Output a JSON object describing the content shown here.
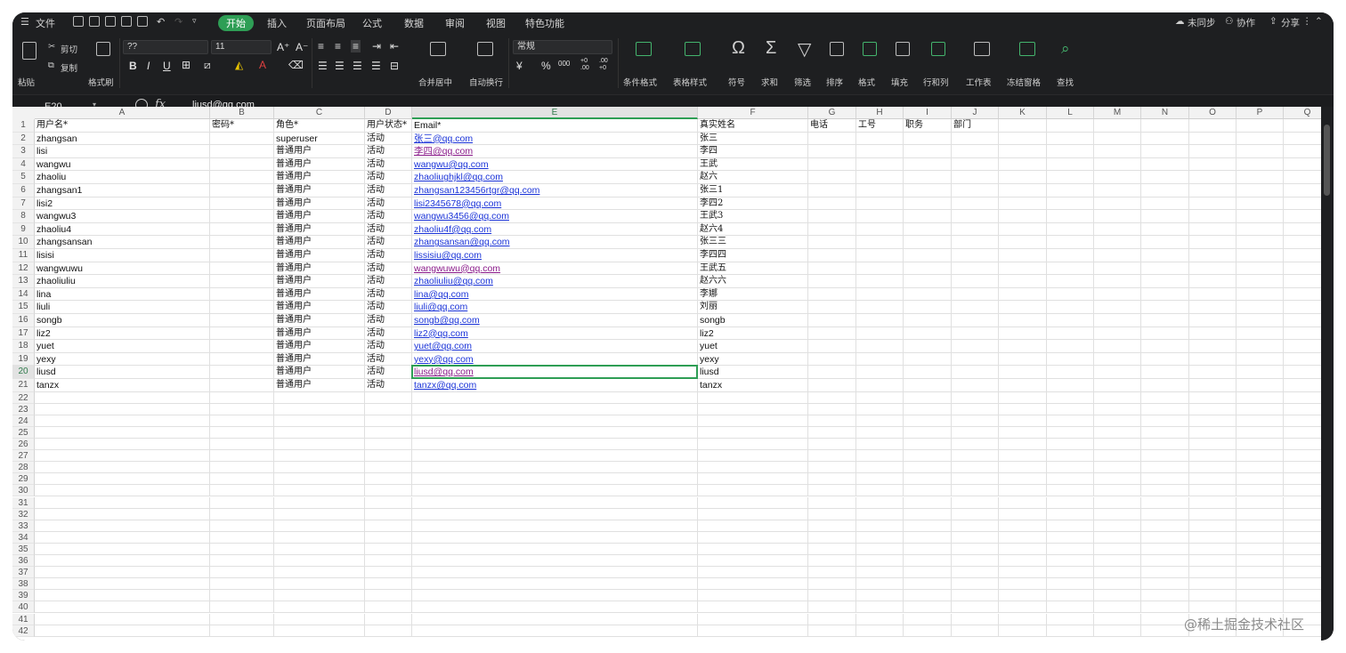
{
  "menubar": {
    "file": "文件",
    "tabs": [
      "开始",
      "插入",
      "页面布局",
      "公式",
      "数据",
      "审阅",
      "视图",
      "特色功能"
    ],
    "sync": "未同步",
    "collab": "协作",
    "share": "分享"
  },
  "ribbon": {
    "paste": "粘贴",
    "cut": "剪切",
    "copy": "复制",
    "format_painter": "格式刷",
    "font_name": "??",
    "font_size": "11",
    "merge_center": "合并居中",
    "wrap": "自动换行",
    "number_format": "常规",
    "cond_format": "条件格式",
    "table_style": "表格样式",
    "symbol": "符号",
    "sum": "求和",
    "filter": "筛选",
    "sort": "排序",
    "format": "格式",
    "fill": "填充",
    "row_col": "行和列",
    "worksheet": "工作表",
    "freeze": "冻结窗格",
    "find": "查找",
    "currency": "¥",
    "percent": "%",
    "thousands": "000",
    "dec_inc": "+0 .00",
    "dec_dec": ".00 +0"
  },
  "formula_bar": {
    "cell_ref": "E20",
    "fx": "fx",
    "value": "liusd@qq.com"
  },
  "columns": [
    "A",
    "B",
    "C",
    "D",
    "E",
    "F",
    "G",
    "H",
    "I",
    "J",
    "K",
    "L",
    "M",
    "N",
    "O",
    "P",
    "Q"
  ],
  "selected_column": "E",
  "selected_row": 20,
  "header_row": [
    "用户名*",
    "密码*",
    "角色*",
    "用户状态*",
    "Email*",
    "真实姓名",
    "电话",
    "工号",
    "职务",
    "部门"
  ],
  "rows": [
    {
      "n": "2",
      "a": "zhangsan",
      "c": "superuser",
      "d": "活动",
      "e": "张三@qq.com",
      "f": "张三",
      "visited": false
    },
    {
      "n": "3",
      "a": "lisi",
      "c": "普通用户",
      "d": "活动",
      "e": "李四@qq.com",
      "f": "李四",
      "visited": true
    },
    {
      "n": "4",
      "a": "wangwu",
      "c": "普通用户",
      "d": "活动",
      "e": "wangwu@qq.com",
      "f": "王武",
      "visited": false
    },
    {
      "n": "5",
      "a": "zhaoliu",
      "c": "普通用户",
      "d": "活动",
      "e": "zhaoliughjkl@qq.com",
      "f": "赵六",
      "visited": false
    },
    {
      "n": "6",
      "a": "zhangsan1",
      "c": "普通用户",
      "d": "活动",
      "e": "zhangsan123456rtgr@qq.com",
      "f": "张三1",
      "visited": false
    },
    {
      "n": "7",
      "a": "lisi2",
      "c": "普通用户",
      "d": "活动",
      "e": "lisi2345678@qq.com",
      "f": "李四2",
      "visited": false
    },
    {
      "n": "8",
      "a": "wangwu3",
      "c": "普通用户",
      "d": "活动",
      "e": "wangwu3456@qq.com",
      "f": "王武3",
      "visited": false
    },
    {
      "n": "9",
      "a": "zhaoliu4",
      "c": "普通用户",
      "d": "活动",
      "e": "zhaoliu4f@qq.com",
      "f": "赵六4",
      "visited": false
    },
    {
      "n": "10",
      "a": "zhangsansan",
      "c": "普通用户",
      "d": "活动",
      "e": "zhangsansan@qq.com",
      "f": "张三三",
      "visited": false
    },
    {
      "n": "11",
      "a": "lisisi",
      "c": "普通用户",
      "d": "活动",
      "e": "lissisiu@qq.com",
      "f": "李四四",
      "visited": false
    },
    {
      "n": "12",
      "a": "wangwuwu",
      "c": "普通用户",
      "d": "活动",
      "e": "wangwuwu@qq.com",
      "f": "王武五",
      "visited": true
    },
    {
      "n": "13",
      "a": "zhaoliuliu",
      "c": "普通用户",
      "d": "活动",
      "e": "zhaoliuliu@qq.com",
      "f": "赵六六",
      "visited": false
    },
    {
      "n": "14",
      "a": "lina",
      "c": "普通用户",
      "d": "活动",
      "e": "lina@qq.com",
      "f": "李娜",
      "visited": false
    },
    {
      "n": "15",
      "a": "liuli",
      "c": "普通用户",
      "d": "活动",
      "e": "liuli@qq.com",
      "f": "刘丽",
      "visited": false
    },
    {
      "n": "16",
      "a": "songb",
      "c": "普通用户",
      "d": "活动",
      "e": "songb@qq.com",
      "f": "songb",
      "visited": false
    },
    {
      "n": "17",
      "a": "liz2",
      "c": "普通用户",
      "d": "活动",
      "e": "liz2@qq.com",
      "f": "liz2",
      "visited": false
    },
    {
      "n": "18",
      "a": "yuet",
      "c": "普通用户",
      "d": "活动",
      "e": "yuet@qq.com",
      "f": "yuet",
      "visited": false
    },
    {
      "n": "19",
      "a": "yexy",
      "c": "普通用户",
      "d": "活动",
      "e": "yexy@qq.com",
      "f": "yexy",
      "visited": false
    },
    {
      "n": "20",
      "a": "liusd",
      "c": "普通用户",
      "d": "活动",
      "e": "liusd@qq.com",
      "f": "liusd",
      "visited": true
    },
    {
      "n": "21",
      "a": "tanzx",
      "c": "普通用户",
      "d": "活动",
      "e": "tanzx@qq.com",
      "f": "tanzx",
      "visited": false
    }
  ],
  "empty_row_numbers": [
    "22",
    "23",
    "24",
    "25",
    "26",
    "27",
    "28",
    "29",
    "30",
    "31",
    "32",
    "33",
    "34",
    "35",
    "36",
    "37",
    "38",
    "39",
    "40",
    "41",
    "42"
  ],
  "watermark": "@稀土掘金技术社区"
}
